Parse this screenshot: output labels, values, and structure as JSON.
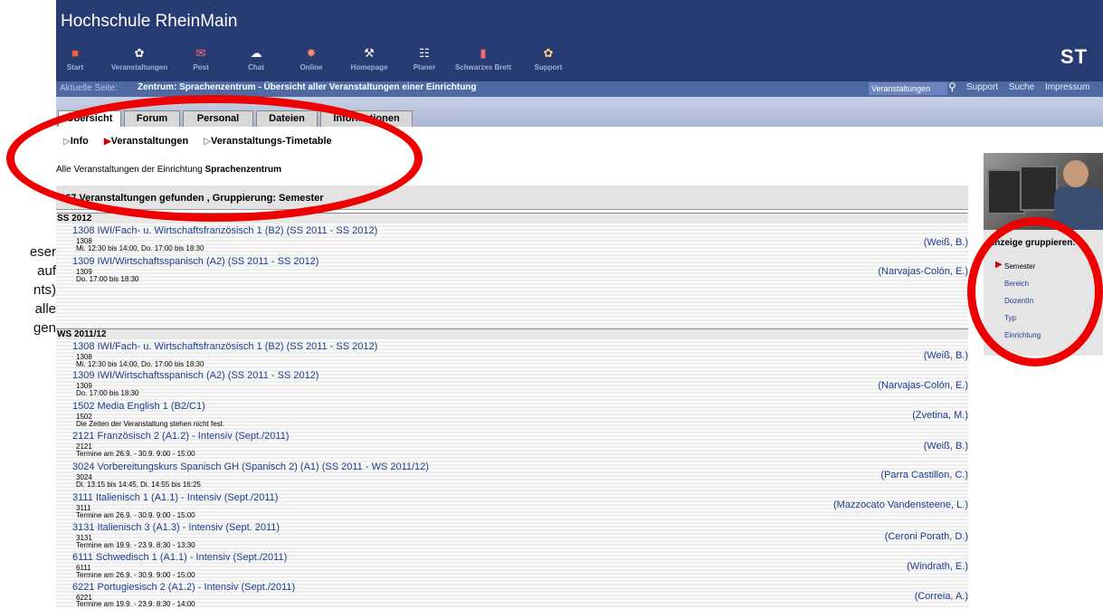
{
  "left_cut_text": [
    "eser",
    "auf",
    "",
    "nts)",
    "alle",
    "gen"
  ],
  "header": {
    "brand": "Hochschule RheinMain",
    "logo_partial": "ST",
    "nav": [
      {
        "label": "Start",
        "icon": "home-icon"
      },
      {
        "label": "Veranstaltungen",
        "icon": "courses-icon"
      },
      {
        "label": "Post",
        "icon": "mail-icon"
      },
      {
        "label": "Chat",
        "icon": "chat-icon"
      },
      {
        "label": "Online",
        "icon": "online-icon"
      },
      {
        "label": "Homepage",
        "icon": "homepage-icon"
      },
      {
        "label": "Planer",
        "icon": "planner-icon"
      },
      {
        "label": "Schwarzes Brett",
        "icon": "board-icon"
      },
      {
        "label": "Support",
        "icon": "support-icon"
      }
    ]
  },
  "crumb": {
    "label": "Aktuelle Seite:",
    "text": "Zentrum: Sprachenzentrum - Übersicht aller Veranstaltungen einer Einrichtung"
  },
  "search": {
    "select_value": "Veranstaltungen",
    "links": [
      "Support",
      "Suche",
      "Impressum"
    ]
  },
  "tabs": [
    "Übersicht",
    "Forum",
    "Personal",
    "Dateien",
    "Informationen"
  ],
  "subnav": [
    "Info",
    "Veranstaltungen",
    "Veranstaltungs-Timetable"
  ],
  "intro": {
    "prefix": "Alle Veranstaltungen der Einrichtung ",
    "name": "Sprachenzentrum"
  },
  "found_text": "267 Veranstaltungen gefunden , Gruppierung: Semester",
  "groups": [
    {
      "name": "SS 2012",
      "courses": [
        {
          "title": "1308 IWI/Fach- u. Wirtschaftsfranzösisch 1 (B2) (SS 2011 - SS 2012)",
          "num": "1308",
          "time": "Mi. 12:30 bis 14:00, Do. 17:00 bis 18:30",
          "lecturer": "(Weiß, B.)"
        },
        {
          "title": "1309 IWI/Wirtschaftsspanisch (A2) (SS 2011 - SS 2012)",
          "num": "1309",
          "time": "Do. 17:00 bis 18:30",
          "lecturer": "(Narvajas-Colón, E.)"
        }
      ]
    },
    {
      "name": "WS 2011/12",
      "courses": [
        {
          "title": "1308 IWI/Fach- u. Wirtschaftsfranzösisch 1 (B2) (SS 2011 - SS 2012)",
          "num": "1308",
          "time": "Mi. 12:30 bis 14:00, Do. 17:00 bis 18:30",
          "lecturer": "(Weiß, B.)"
        },
        {
          "title": "1309 IWI/Wirtschaftsspanisch (A2) (SS 2011 - SS 2012)",
          "num": "1309",
          "time": "Do. 17:00 bis 18:30",
          "lecturer": "(Narvajas-Colón, E.)"
        },
        {
          "title": "1502 Media English 1 (B2/C1)",
          "num": "1502",
          "time": "Die Zeiten der Veranstaltung stehen nicht fest.",
          "lecturer": "(Zvetina, M.)"
        },
        {
          "title": "2121 Französisch 2 (A1.2) - Intensiv (Sept./2011)",
          "num": "2121",
          "time": "Termine am 26.9. - 30.9. 9:00 - 15:00",
          "lecturer": "(Weiß, B.)"
        },
        {
          "title": "3024 Vorbereitungskurs Spanisch GH (Spanisch 2) (A1) (SS 2011 - WS 2011/12)",
          "num": "3024",
          "time": "Di. 13:15 bis 14:45, Di. 14:55 bis 16:25",
          "lecturer": "(Parra Castillon, C.)"
        },
        {
          "title": "3111 Italienisch 1 (A1.1) - Intensiv (Sept./2011)",
          "num": "3111",
          "time": "Termine am 26.9. - 30.9. 9:00 - 15:00",
          "lecturer": "(Mazzocato Vandensteene, L.)"
        },
        {
          "title": "3131 Italienisch 3 (A1.3) - Intensiv (Sept. 2011)",
          "num": "3131",
          "time": "Termine am 19.9. - 23.9. 8:30 - 13:30",
          "lecturer": "(Ceroni Porath, D.)"
        },
        {
          "title": "6111 Schwedisch 1 (A1.1) - Intensiv (Sept./2011)",
          "num": "6111",
          "time": "Termine am 26.9. - 30.9. 9:00 - 15:00",
          "lecturer": "(Windrath, E.)"
        },
        {
          "title": "6221 Portugiesisch 2 (A1.2) - Intensiv (Sept./2011)",
          "num": "6221",
          "time": "Termine am 19.9. - 23.9. 8:30 - 14:00",
          "lecturer": "(Correia, A.)"
        }
      ]
    }
  ],
  "group_panel": {
    "title": "Anzeige gruppieren:",
    "options": [
      "Semester",
      "Bereich",
      "DozentIn",
      "Typ",
      "Einrichtung"
    ],
    "selected": "Semester"
  },
  "colors": {
    "header": "#273c72",
    "link": "#1b3d8f",
    "annotation": "#ee0000"
  }
}
